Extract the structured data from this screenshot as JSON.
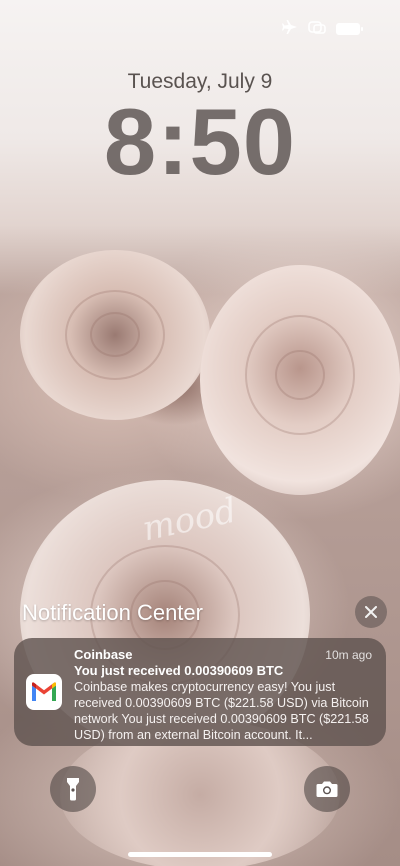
{
  "status_bar": {
    "icons": [
      "airplane-icon",
      "focus-icon",
      "battery-icon"
    ]
  },
  "lock_screen": {
    "date": "Tuesday, July 9",
    "time": "8:50",
    "wallpaper_watermark": "mood"
  },
  "notification_center": {
    "title": "Notification Center",
    "close_icon": "close-icon",
    "notifications": [
      {
        "app_icon": "gmail-icon",
        "app": "Coinbase",
        "time": "10m ago",
        "title": "You just received 0.00390609 BTC",
        "body": "Coinbase makes cryptocurrency easy! You just received 0.00390609 BTC ($221.58 USD) via Bitcoin network You just received 0.00390609 BTC ($221.58 USD) from an external Bitcoin account. It..."
      }
    ]
  },
  "bottom": {
    "left_button_icon": "flashlight-icon",
    "right_button_icon": "camera-icon"
  },
  "colors": {
    "clock": "#6b6361",
    "card_bg": "#605450",
    "gmail_red": "#ea4335",
    "gmail_blue": "#4285f4",
    "gmail_green": "#34a853",
    "gmail_yellow": "#fbbc04"
  }
}
